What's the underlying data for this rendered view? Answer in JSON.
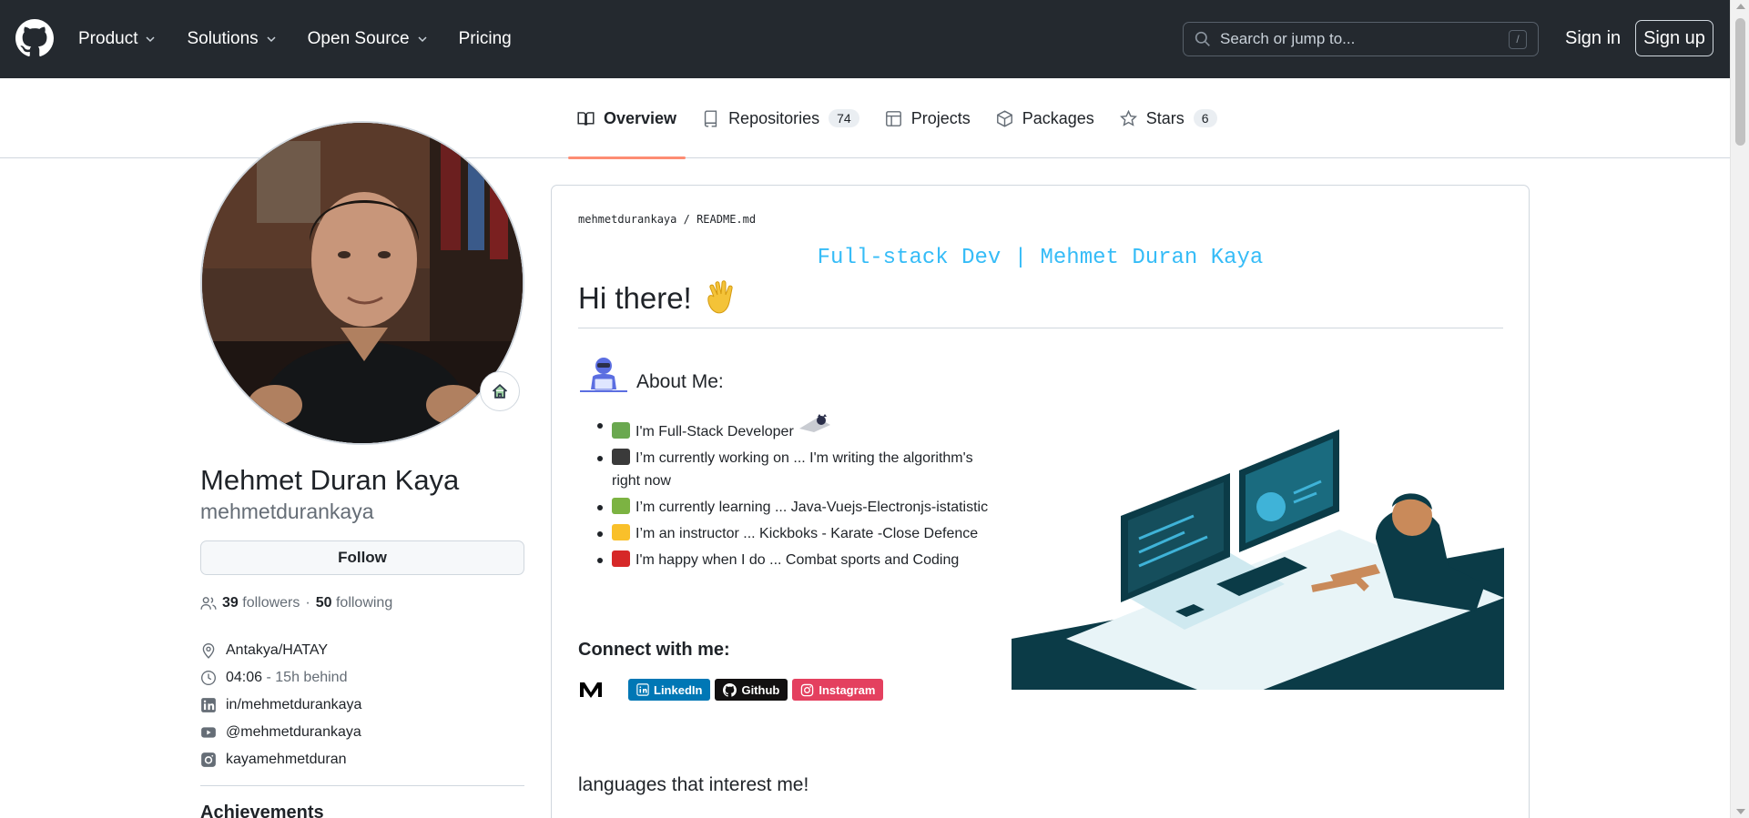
{
  "header": {
    "nav": [
      {
        "label": "Product",
        "has_menu": true
      },
      {
        "label": "Solutions",
        "has_menu": true
      },
      {
        "label": "Open Source",
        "has_menu": true
      },
      {
        "label": "Pricing",
        "has_menu": false
      }
    ],
    "search_placeholder": "Search or jump to...",
    "search_key": "/",
    "signin": "Sign in",
    "signup": "Sign up"
  },
  "tabs": [
    {
      "label": "Overview",
      "count": "",
      "active": true,
      "icon": "book-icon"
    },
    {
      "label": "Repositories",
      "count": "74",
      "active": false,
      "icon": "repo-icon"
    },
    {
      "label": "Projects",
      "count": "",
      "active": false,
      "icon": "table-icon"
    },
    {
      "label": "Packages",
      "count": "",
      "active": false,
      "icon": "package-icon"
    },
    {
      "label": "Stars",
      "count": "6",
      "active": false,
      "icon": "star-icon"
    }
  ],
  "profile": {
    "full_name": "Mehmet Duran Kaya",
    "username": "mehmetdurankaya",
    "follow": "Follow",
    "followers_count": "39",
    "followers_label": "followers",
    "dot": "·",
    "following_count": "50",
    "following_label": "following",
    "location": "Antakya/HATAY",
    "time": "04:06",
    "time_note": "- 15h behind",
    "linkedin": "in/mehmetdurankaya",
    "youtube": "@mehmetdurankaya",
    "instagram": "kayamehmetduran",
    "achievements": "Achievements"
  },
  "readme": {
    "path_user": "mehmetdurankaya",
    "path_sep": "/",
    "path_file": "README.md",
    "typing": "Full-stack Dev | Mehmet Duran Kaya",
    "greeting": "Hi there!",
    "about_title": "About Me:",
    "items": [
      "I'm Full-Stack Developer",
      "I’m currently working on ... I'm writing the algorithm's right now",
      "I’m currently learning ... Java-Vuejs-Electronjs-istatistic",
      "I’m an instructor ... Kickboks - Karate -Close Defence",
      "I'm happy when I do ... Combat sports and Coding"
    ],
    "connect_title": "Connect with me:",
    "badges": [
      {
        "label": "LinkedIn",
        "color": "#0077b5"
      },
      {
        "label": "Github",
        "color": "#121011"
      },
      {
        "label": "Instagram",
        "color": "#e4405f"
      }
    ],
    "languages_title": "languages that interest me!"
  },
  "colors": {
    "header_bg": "#24292f",
    "active_tab_underline": "#fd8c73",
    "typing_text": "#36bcf7",
    "illustration_dark": "#0b3b47",
    "illustration_accent": "#3fb3d8"
  }
}
